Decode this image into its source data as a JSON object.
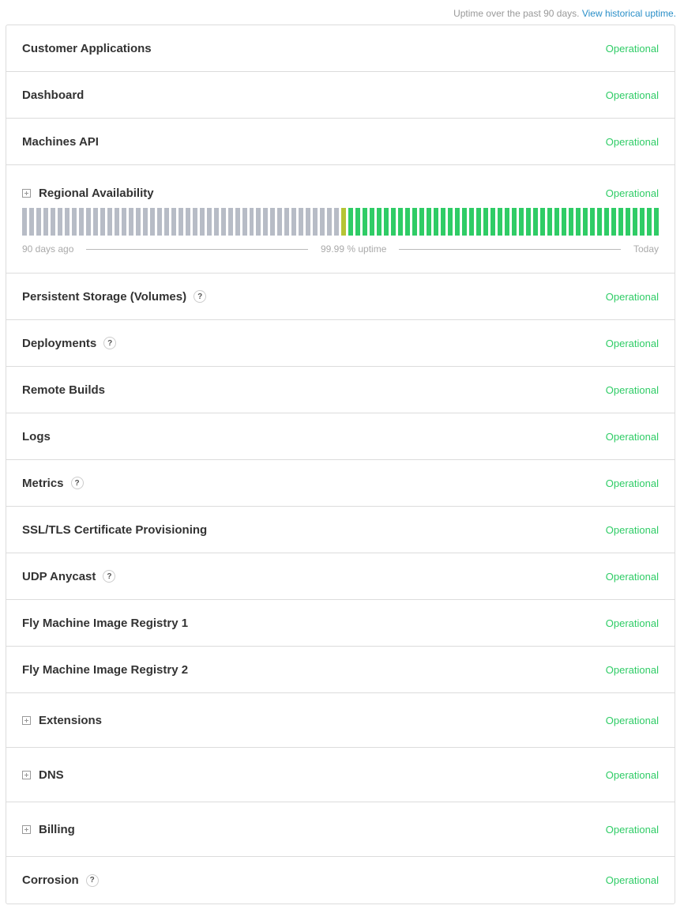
{
  "header": {
    "uptime_text": "Uptime over the past 90 days.",
    "historical_link": "View historical uptime."
  },
  "colors": {
    "operational": "#2fcc66",
    "no_data": "#b7bcc6",
    "partial": "#b5c435",
    "link": "#2a8fc8"
  },
  "components": [
    {
      "name": "Customer Applications",
      "status": "Operational",
      "expandable": false,
      "help": false
    },
    {
      "name": "Dashboard",
      "status": "Operational",
      "expandable": false,
      "help": false
    },
    {
      "name": "Machines API",
      "status": "Operational",
      "expandable": false,
      "help": false
    },
    {
      "name": "Regional Availability",
      "status": "Operational",
      "expandable": true,
      "help": false
    },
    {
      "name": "Persistent Storage (Volumes)",
      "status": "Operational",
      "expandable": false,
      "help": true
    },
    {
      "name": "Deployments",
      "status": "Operational",
      "expandable": false,
      "help": true
    },
    {
      "name": "Remote Builds",
      "status": "Operational",
      "expandable": false,
      "help": false
    },
    {
      "name": "Logs",
      "status": "Operational",
      "expandable": false,
      "help": false
    },
    {
      "name": "Metrics",
      "status": "Operational",
      "expandable": false,
      "help": true
    },
    {
      "name": "SSL/TLS Certificate Provisioning",
      "status": "Operational",
      "expandable": false,
      "help": false
    },
    {
      "name": "UDP Anycast",
      "status": "Operational",
      "expandable": false,
      "help": true
    },
    {
      "name": "Fly Machine Image Registry 1",
      "status": "Operational",
      "expandable": false,
      "help": false
    },
    {
      "name": "Fly Machine Image Registry 2",
      "status": "Operational",
      "expandable": false,
      "help": false
    },
    {
      "name": "Extensions",
      "status": "Operational",
      "expandable": true,
      "help": false
    },
    {
      "name": "DNS",
      "status": "Operational",
      "expandable": true,
      "help": false
    },
    {
      "name": "Billing",
      "status": "Operational",
      "expandable": true,
      "help": false
    },
    {
      "name": "Corrosion",
      "status": "Operational",
      "expandable": false,
      "help": true
    }
  ],
  "help_glyph": "?",
  "uptime": {
    "component": "Regional Availability",
    "start_label": "90 days ago",
    "uptime_label": "99.99 % uptime",
    "end_label": "Today",
    "days": [
      "nodata",
      "nodata",
      "nodata",
      "nodata",
      "nodata",
      "nodata",
      "nodata",
      "nodata",
      "nodata",
      "nodata",
      "nodata",
      "nodata",
      "nodata",
      "nodata",
      "nodata",
      "nodata",
      "nodata",
      "nodata",
      "nodata",
      "nodata",
      "nodata",
      "nodata",
      "nodata",
      "nodata",
      "nodata",
      "nodata",
      "nodata",
      "nodata",
      "nodata",
      "nodata",
      "nodata",
      "nodata",
      "nodata",
      "nodata",
      "nodata",
      "nodata",
      "nodata",
      "nodata",
      "nodata",
      "nodata",
      "nodata",
      "nodata",
      "nodata",
      "nodata",
      "nodata",
      "partial",
      "up",
      "up",
      "up",
      "up",
      "up",
      "up",
      "up",
      "up",
      "up",
      "up",
      "up",
      "up",
      "up",
      "up",
      "up",
      "up",
      "up",
      "up",
      "up",
      "up",
      "up",
      "up",
      "up",
      "up",
      "up",
      "up",
      "up",
      "up",
      "up",
      "up",
      "up",
      "up",
      "up",
      "up",
      "up",
      "up",
      "up",
      "up",
      "up",
      "up",
      "up",
      "up",
      "up",
      "up"
    ]
  }
}
